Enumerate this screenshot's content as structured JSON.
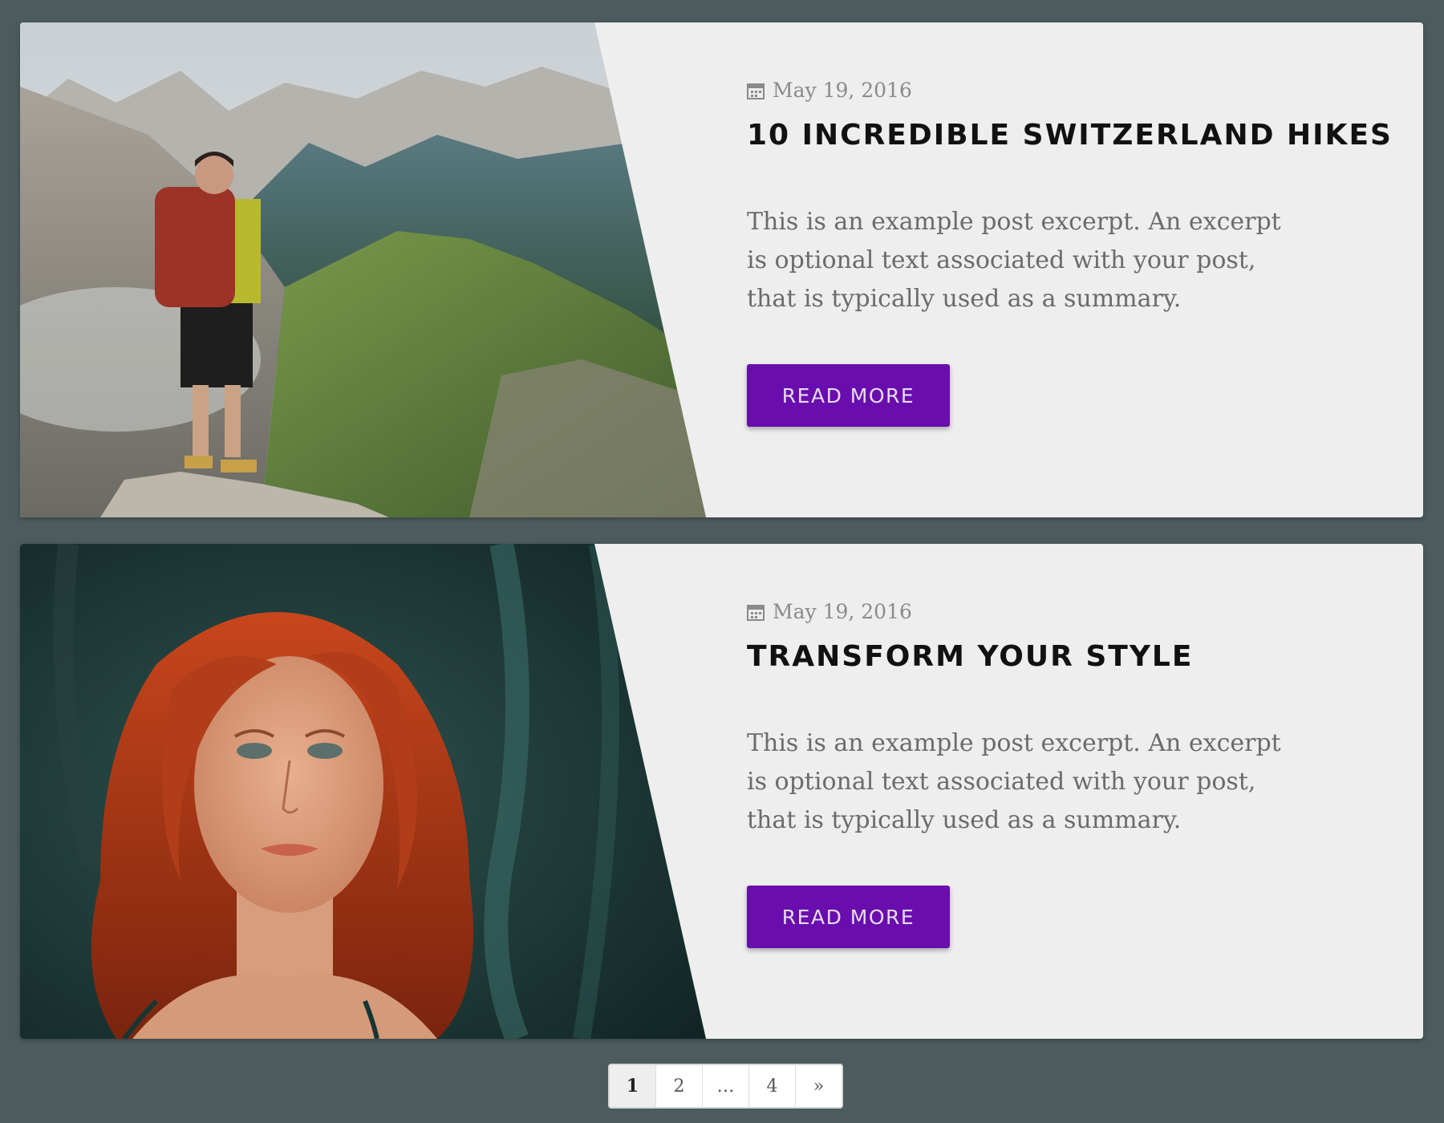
{
  "posts": [
    {
      "date": "May 19, 2016",
      "title": "10 INCREDIBLE SWITZERLAND HIKES",
      "excerpt": "This is an example post excerpt. An excerpt is optional text associated with your post, that is typically used as a summary.",
      "button_label": "READ MORE",
      "image_icon": "hiker-on-mountain-photo"
    },
    {
      "date": "May 19, 2016",
      "title": "TRANSFORM YOUR STYLE",
      "excerpt": "This is an example post excerpt. An excerpt is optional text associated with your post, that is typically used as a summary.",
      "button_label": "READ MORE",
      "image_icon": "red-haired-woman-portrait-photo"
    }
  ],
  "pagination": {
    "pages": [
      "1",
      "2",
      "…",
      "4",
      "»"
    ],
    "current": "1"
  },
  "colors": {
    "background": "#4c5b5d",
    "card": "#eeeeee",
    "button": "#6a0dad",
    "title": "#111111",
    "excerpt": "#6b6b6b",
    "date": "#8a8a8a"
  }
}
